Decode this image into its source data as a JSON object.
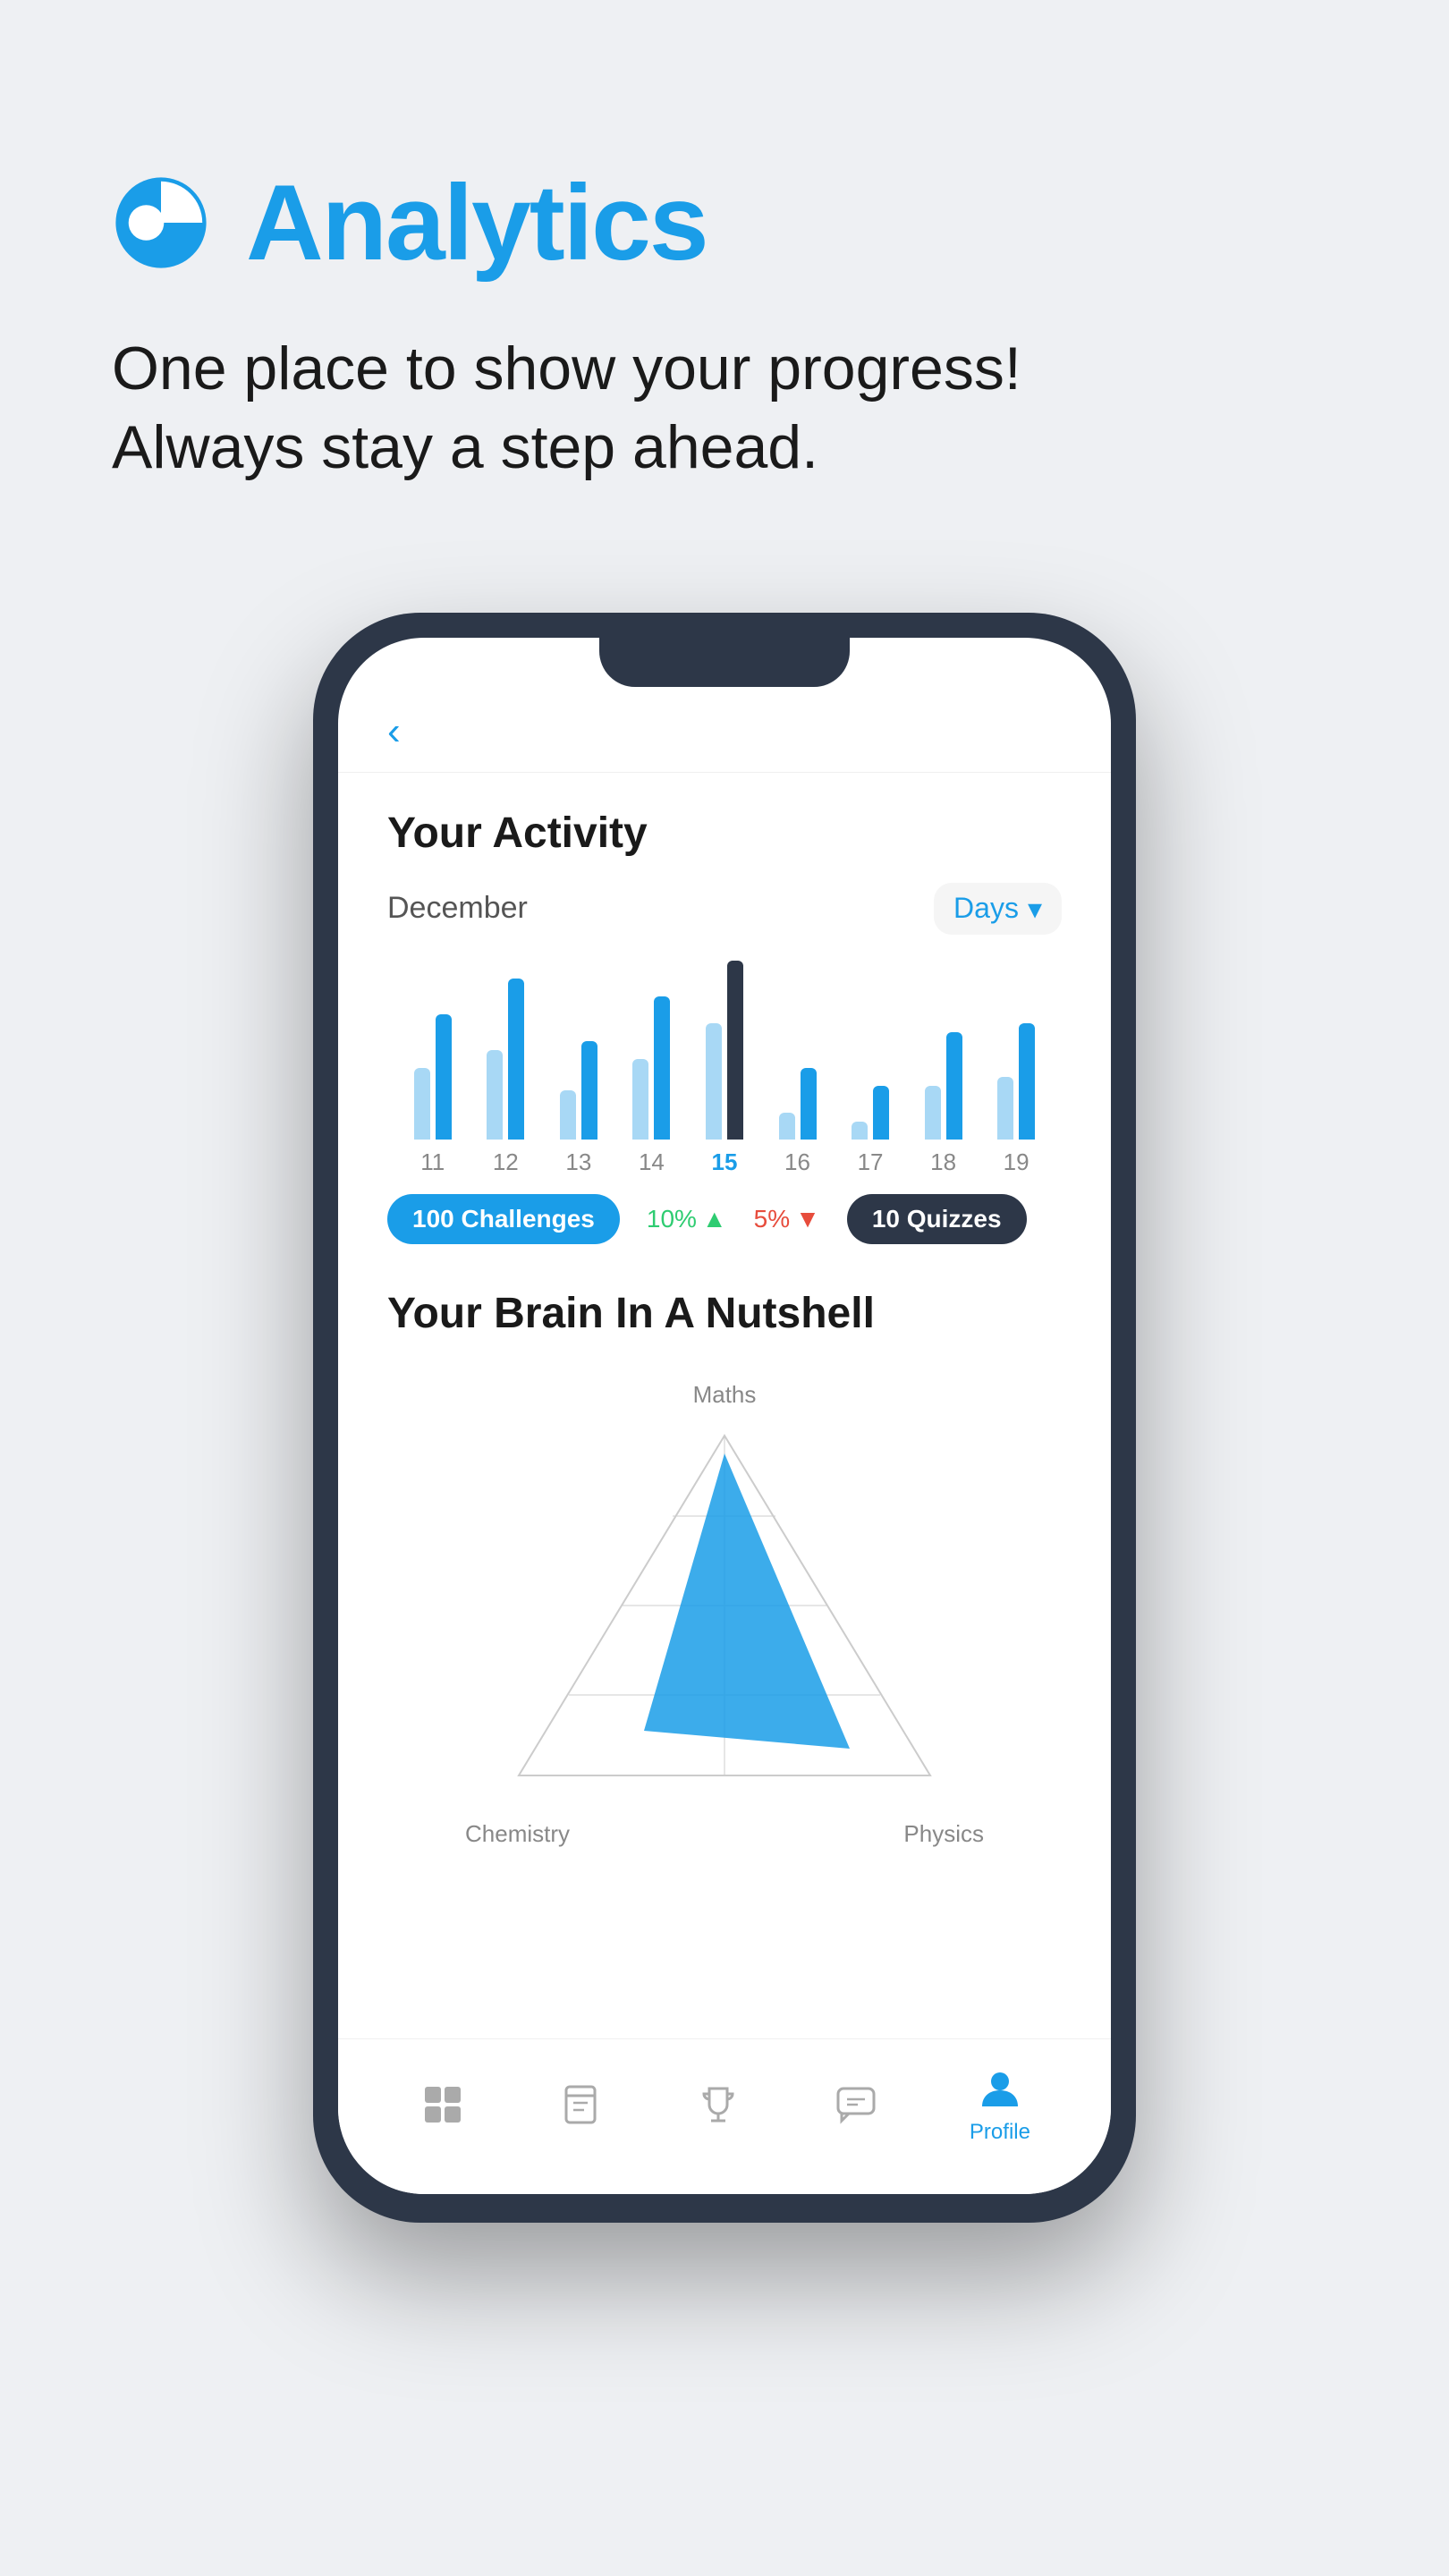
{
  "header": {
    "title": "Analytics",
    "subtitle_line1": "One place to show your progress!",
    "subtitle_line2": "Always stay a step ahead.",
    "icon_name": "analytics-pie-icon"
  },
  "phone": {
    "back_label": "Back",
    "screen": {
      "activity_section": {
        "title": "Your Activity",
        "month": "December",
        "period_selector": "Days",
        "bars": [
          {
            "day": "11",
            "heights": [
              80,
              140
            ],
            "active": false
          },
          {
            "day": "12",
            "heights": [
              120,
              180
            ],
            "active": false
          },
          {
            "day": "13",
            "heights": [
              60,
              110
            ],
            "active": false
          },
          {
            "day": "14",
            "heights": [
              100,
              160
            ],
            "active": false
          },
          {
            "day": "15",
            "heights": [
              150,
              200
            ],
            "active": true
          },
          {
            "day": "16",
            "heights": [
              40,
              80
            ],
            "active": false
          },
          {
            "day": "17",
            "heights": [
              30,
              60
            ],
            "active": false
          },
          {
            "day": "18",
            "heights": [
              70,
              120
            ],
            "active": false
          },
          {
            "day": "19",
            "heights": [
              80,
              130
            ],
            "active": false
          }
        ],
        "stats": [
          {
            "label": "100 Challenges",
            "type": "blue"
          },
          {
            "label": "10%",
            "change": "up"
          },
          {
            "label": "5%",
            "change": "down"
          },
          {
            "label": "10 Quizzes",
            "type": "dark"
          }
        ]
      },
      "brain_section": {
        "title": "Your Brain In A Nutshell",
        "chart_labels": {
          "top": "Maths",
          "bottom_left": "Chemistry",
          "bottom_right": "Physics"
        }
      },
      "bottom_nav": [
        {
          "label": "",
          "icon": "grid-icon",
          "active": false
        },
        {
          "label": "",
          "icon": "book-icon",
          "active": false
        },
        {
          "label": "",
          "icon": "trophy-icon",
          "active": false
        },
        {
          "label": "",
          "icon": "chat-icon",
          "active": false
        },
        {
          "label": "Profile",
          "icon": "profile-icon",
          "active": true
        }
      ]
    }
  },
  "colors": {
    "blue": "#1a9de8",
    "dark": "#2d3748",
    "bg": "#eef0f3",
    "green": "#2ecc71",
    "red": "#e74c3c"
  }
}
